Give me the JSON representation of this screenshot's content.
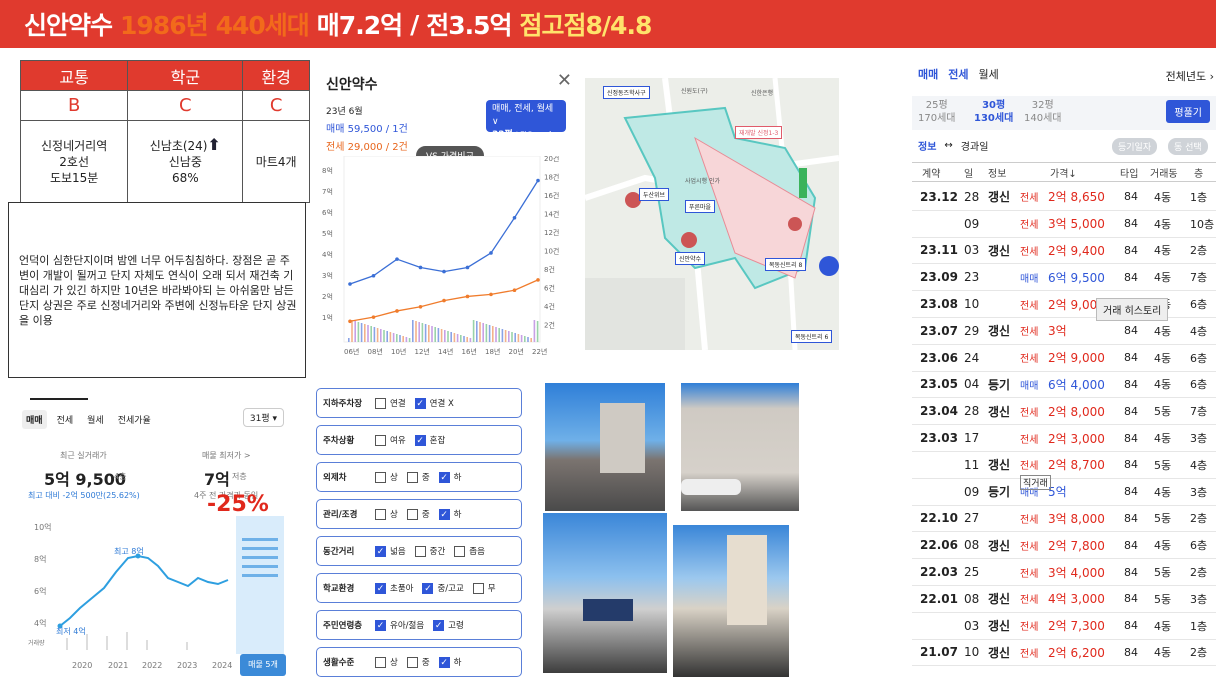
{
  "header": {
    "name": "신안약수",
    "year": "1986년",
    "units": "440세대",
    "sale": "매7.2억",
    "sep": "/",
    "rent": "전3.5억",
    "score": "점고점8/4.8"
  },
  "rating": {
    "heads": [
      "교통",
      "학군",
      "환경"
    ],
    "grades": [
      "B",
      "C",
      "C"
    ],
    "traffic": [
      "신정네거리역",
      "2호선",
      "도보15분"
    ],
    "school": [
      "신남초(24)",
      "신남중",
      "68%"
    ],
    "env": "마트4개"
  },
  "note": "언덕이 심한단지이며 밤엔 너무 어두침침하다. 장점은 곧 주변이 개발이 될꺼고 단지 자체도 연식이 오래 되서 재건축 기대심리 가 있긴 하지만 10년은 바라봐야되 는 아쉬움만 남든 단지 상권은 주로 신정네거리와 주변에 신정뉴타운 단지 상권을 이용",
  "price_card": {
    "tabs": [
      "매매",
      "전세",
      "월세",
      "전세가율"
    ],
    "size": "31평 ▾",
    "recent_label": "최근 실거래가",
    "recent_value": "5억 9,500",
    "recent_floor": "4층",
    "recent_delta": "최고 대비 -2억 500만(25.62%)",
    "min_label": "매물 최저가 >",
    "min_value": "7억",
    "min_floor": "저층",
    "min_note": "4주 전 가격과 동일",
    "pct": "-25%",
    "high_label": "최고 8억",
    "low_label": "최저 4억",
    "y_ticks": [
      "10억",
      "8억",
      "6억",
      "4억"
    ],
    "vol_label": "거래량",
    "x_ticks": [
      "2020",
      "2021",
      "2022",
      "2023",
      "2024"
    ],
    "btn": "매물 5개"
  },
  "chart_panel": {
    "title": "신안약수",
    "month": "23년 6월",
    "sale": "매매 59,500 / 1건",
    "rent": "전세 29,000 / 2건",
    "tag1": "매매, 전세, 월세 ∨",
    "tag2_main": "32평",
    "tag2_sub": "| 전용 87㎡",
    "vs": "VS 가격비교",
    "y_left": [
      "8억",
      "7억",
      "6억",
      "5억",
      "4억",
      "3억",
      "2억",
      "1억"
    ],
    "y_right": [
      "20건",
      "18건",
      "16건",
      "14건",
      "12건",
      "10건",
      "8건",
      "6건",
      "4건",
      "2건"
    ],
    "x_ticks": [
      "06년",
      "08년",
      "10년",
      "12년",
      "14년",
      "16년",
      "18년",
      "20년",
      "22년"
    ]
  },
  "chart_data": {
    "type": "line",
    "title": "",
    "x": [
      "06년",
      "08년",
      "10년",
      "12년",
      "14년",
      "16년",
      "18년",
      "20년",
      "22년"
    ],
    "ylim": [
      0,
      8.5
    ],
    "series": [
      {
        "name": "매매",
        "values": [
          2.8,
          3.2,
          4.0,
          3.6,
          3.4,
          3.6,
          4.3,
          6.0,
          7.8
        ]
      },
      {
        "name": "전세",
        "values": [
          1.0,
          1.2,
          1.5,
          1.7,
          2.0,
          2.2,
          2.3,
          2.5,
          3.0
        ]
      }
    ]
  },
  "checklist": [
    {
      "label": "지하주차장",
      "opts": [
        {
          "t": "연결",
          "c": false
        },
        {
          "t": "연결 X",
          "c": true
        }
      ]
    },
    {
      "label": "주차상황",
      "opts": [
        {
          "t": "여유",
          "c": false
        },
        {
          "t": "혼잡",
          "c": true
        }
      ]
    },
    {
      "label": "외제차",
      "opts": [
        {
          "t": "상",
          "c": false
        },
        {
          "t": "중",
          "c": false
        },
        {
          "t": "하",
          "c": true
        }
      ]
    },
    {
      "label": "관리/조경",
      "opts": [
        {
          "t": "상",
          "c": false
        },
        {
          "t": "중",
          "c": false
        },
        {
          "t": "하",
          "c": true
        }
      ]
    },
    {
      "label": "동간거리",
      "opts": [
        {
          "t": "넓음",
          "c": true
        },
        {
          "t": "중간",
          "c": false
        },
        {
          "t": "좁음",
          "c": false
        }
      ]
    },
    {
      "label": "학교환경",
      "opts": [
        {
          "t": "초품아",
          "c": true
        },
        {
          "t": "중/고교",
          "c": true
        },
        {
          "t": "무",
          "c": false
        }
      ]
    },
    {
      "label": "주민연령층",
      "opts": [
        {
          "t": "유아/젊음",
          "c": true
        },
        {
          "t": "고령",
          "c": true
        }
      ]
    },
    {
      "label": "생활수준",
      "opts": [
        {
          "t": "상",
          "c": false
        },
        {
          "t": "중",
          "c": false
        },
        {
          "t": "하",
          "c": true
        }
      ]
    }
  ],
  "map": {
    "labels": [
      "신정동즈학사구",
      "신한은행",
      "신원도(구)",
      "사업시행 인가",
      "두산위브",
      "재개발 신정1-3",
      "신안약수",
      "푸른마을",
      "목동신트리 8",
      "목동신트리 6"
    ]
  },
  "tx": {
    "tabs": [
      "매매",
      "전세",
      "월세"
    ],
    "year_filter": "전체년도 ›",
    "sizes": [
      {
        "p": "25평",
        "u": "170세대"
      },
      {
        "p": "30평",
        "u": "130세대"
      },
      {
        "p": "32평",
        "u": "140세대"
      }
    ],
    "pf": "평풀기",
    "info": "정보",
    "arrow": "↔",
    "info2": "경과일",
    "pill1": "등기일자",
    "pill2": "동 선택",
    "heads": [
      "계약",
      "일",
      "정보",
      "가격↓",
      "타입",
      "거래동",
      "층"
    ],
    "tooltip": "거래 히스토리",
    "rows": [
      {
        "ym": "23.12",
        "d": "28",
        "i": "갱신",
        "k": "전세",
        "p": "2억 8,650",
        "t": "84",
        "dong": "4동",
        "f": "1층"
      },
      {
        "ym": "",
        "d": "09",
        "i": "",
        "k": "전세",
        "p": "3억 5,000",
        "t": "84",
        "dong": "4동",
        "f": "10층"
      },
      {
        "ym": "23.11",
        "d": "03",
        "i": "갱신",
        "k": "전세",
        "p": "2억 9,400",
        "t": "84",
        "dong": "4동",
        "f": "2층"
      },
      {
        "ym": "23.09",
        "d": "23",
        "i": "",
        "k": "매매",
        "p": "6억 9,500",
        "t": "84",
        "dong": "4동",
        "f": "7층"
      },
      {
        "ym": "23.08",
        "d": "10",
        "i": "",
        "k": "전세",
        "p": "2억 9,000",
        "t": "84",
        "dong": "4동",
        "f": "6층"
      },
      {
        "ym": "23.07",
        "d": "29",
        "i": "갱신",
        "k": "전세",
        "p": "3억",
        "t": "84",
        "dong": "4동",
        "f": "4층"
      },
      {
        "ym": "23.06",
        "d": "24",
        "i": "",
        "k": "전세",
        "p": "2억 9,000",
        "t": "84",
        "dong": "4동",
        "f": "6층"
      },
      {
        "ym": "23.05",
        "d": "04",
        "i": "등기",
        "k": "매매",
        "p": "6억 4,000",
        "t": "84",
        "dong": "4동",
        "f": "6층"
      },
      {
        "ym": "23.04",
        "d": "28",
        "i": "갱신",
        "k": "전세",
        "p": "2억 8,000",
        "t": "84",
        "dong": "5동",
        "f": "7층"
      },
      {
        "ym": "23.03",
        "d": "17",
        "i": "",
        "k": "전세",
        "p": "2억 3,000",
        "t": "84",
        "dong": "4동",
        "f": "3층"
      },
      {
        "ym": "",
        "d": "11",
        "i": "갱신",
        "k": "전세",
        "p": "2억 8,700",
        "t": "84",
        "dong": "5동",
        "f": "4층"
      },
      {
        "ym": "",
        "d": "09",
        "i": "등기",
        "k": "매매",
        "p": "5억",
        "t": "84",
        "dong": "4동",
        "f": "3층",
        "extra": "직거래"
      },
      {
        "ym": "22.10",
        "d": "27",
        "i": "",
        "k": "전세",
        "p": "3억 8,000",
        "t": "84",
        "dong": "5동",
        "f": "2층"
      },
      {
        "ym": "22.06",
        "d": "08",
        "i": "갱신",
        "k": "전세",
        "p": "2억 7,800",
        "t": "84",
        "dong": "4동",
        "f": "6층"
      },
      {
        "ym": "22.03",
        "d": "25",
        "i": "",
        "k": "전세",
        "p": "3억 4,000",
        "t": "84",
        "dong": "5동",
        "f": "2층"
      },
      {
        "ym": "22.01",
        "d": "08",
        "i": "갱신",
        "k": "전세",
        "p": "4억 3,000",
        "t": "84",
        "dong": "5동",
        "f": "3층"
      },
      {
        "ym": "",
        "d": "03",
        "i": "갱신",
        "k": "전세",
        "p": "2억 7,300",
        "t": "84",
        "dong": "4동",
        "f": "1층"
      },
      {
        "ym": "21.07",
        "d": "10",
        "i": "갱신",
        "k": "전세",
        "p": "2억 6,200",
        "t": "84",
        "dong": "4동",
        "f": "2층"
      }
    ]
  }
}
